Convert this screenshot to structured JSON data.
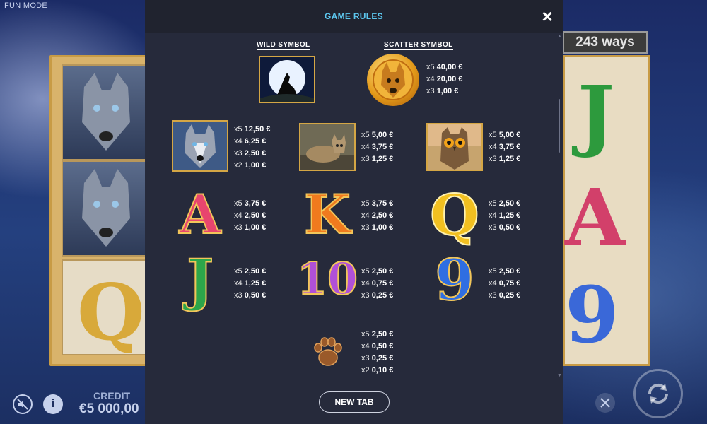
{
  "app": {
    "mode_label": "FUN MODE"
  },
  "background": {
    "ways_label": "243 ways",
    "credit_label": "CREDIT",
    "credit_value": "€5 000,00",
    "info_icon": "i"
  },
  "modal": {
    "title": "GAME RULES",
    "close_icon": "×",
    "wild": {
      "label": "WILD SYMBOL",
      "icon": "howling-wolf-moon-icon"
    },
    "scatter": {
      "label": "SCATTER SYMBOL",
      "icon": "wolf-coin-icon",
      "pays": [
        {
          "mult": "x5",
          "value": "40,00 €"
        },
        {
          "mult": "x4",
          "value": "20,00 €"
        },
        {
          "mult": "x3",
          "value": "1,00 €"
        }
      ]
    },
    "symbols": [
      {
        "name": "wolf",
        "pays": [
          {
            "mult": "x5",
            "value": "12,50 €"
          },
          {
            "mult": "x4",
            "value": "6,25 €"
          },
          {
            "mult": "x3",
            "value": "2,50 €"
          },
          {
            "mult": "x2",
            "value": "1,00 €"
          }
        ]
      },
      {
        "name": "lynx",
        "pays": [
          {
            "mult": "x5",
            "value": "5,00 €"
          },
          {
            "mult": "x4",
            "value": "3,75 €"
          },
          {
            "mult": "x3",
            "value": "1,25 €"
          }
        ]
      },
      {
        "name": "owl",
        "pays": [
          {
            "mult": "x5",
            "value": "5,00 €"
          },
          {
            "mult": "x4",
            "value": "3,75 €"
          },
          {
            "mult": "x3",
            "value": "1,25 €"
          }
        ]
      },
      {
        "name": "A",
        "glyph": "A",
        "pays": [
          {
            "mult": "x5",
            "value": "3,75 €"
          },
          {
            "mult": "x4",
            "value": "2,50 €"
          },
          {
            "mult": "x3",
            "value": "1,00 €"
          }
        ]
      },
      {
        "name": "K",
        "glyph": "K",
        "pays": [
          {
            "mult": "x5",
            "value": "3,75 €"
          },
          {
            "mult": "x4",
            "value": "2,50 €"
          },
          {
            "mult": "x3",
            "value": "1,00 €"
          }
        ]
      },
      {
        "name": "Q",
        "glyph": "Q",
        "pays": [
          {
            "mult": "x5",
            "value": "2,50 €"
          },
          {
            "mult": "x4",
            "value": "1,25 €"
          },
          {
            "mult": "x3",
            "value": "0,50 €"
          }
        ]
      },
      {
        "name": "J",
        "glyph": "J",
        "pays": [
          {
            "mult": "x5",
            "value": "2,50 €"
          },
          {
            "mult": "x4",
            "value": "1,25 €"
          },
          {
            "mult": "x3",
            "value": "0,50 €"
          }
        ]
      },
      {
        "name": "10",
        "glyph": "10",
        "pays": [
          {
            "mult": "x5",
            "value": "2,50 €"
          },
          {
            "mult": "x4",
            "value": "0,75 €"
          },
          {
            "mult": "x3",
            "value": "0,25 €"
          }
        ]
      },
      {
        "name": "9",
        "glyph": "9",
        "pays": [
          {
            "mult": "x5",
            "value": "2,50 €"
          },
          {
            "mult": "x4",
            "value": "0,75 €"
          },
          {
            "mult": "x3",
            "value": "0,25 €"
          }
        ]
      },
      {
        "name": "paw",
        "pays": [
          {
            "mult": "x5",
            "value": "2,50 €"
          },
          {
            "mult": "x4",
            "value": "0,50 €"
          },
          {
            "mult": "x3",
            "value": "0,25 €"
          },
          {
            "mult": "x2",
            "value": "0,10 €"
          }
        ]
      }
    ],
    "footer": {
      "new_tab_label": "NEW TAB"
    }
  }
}
